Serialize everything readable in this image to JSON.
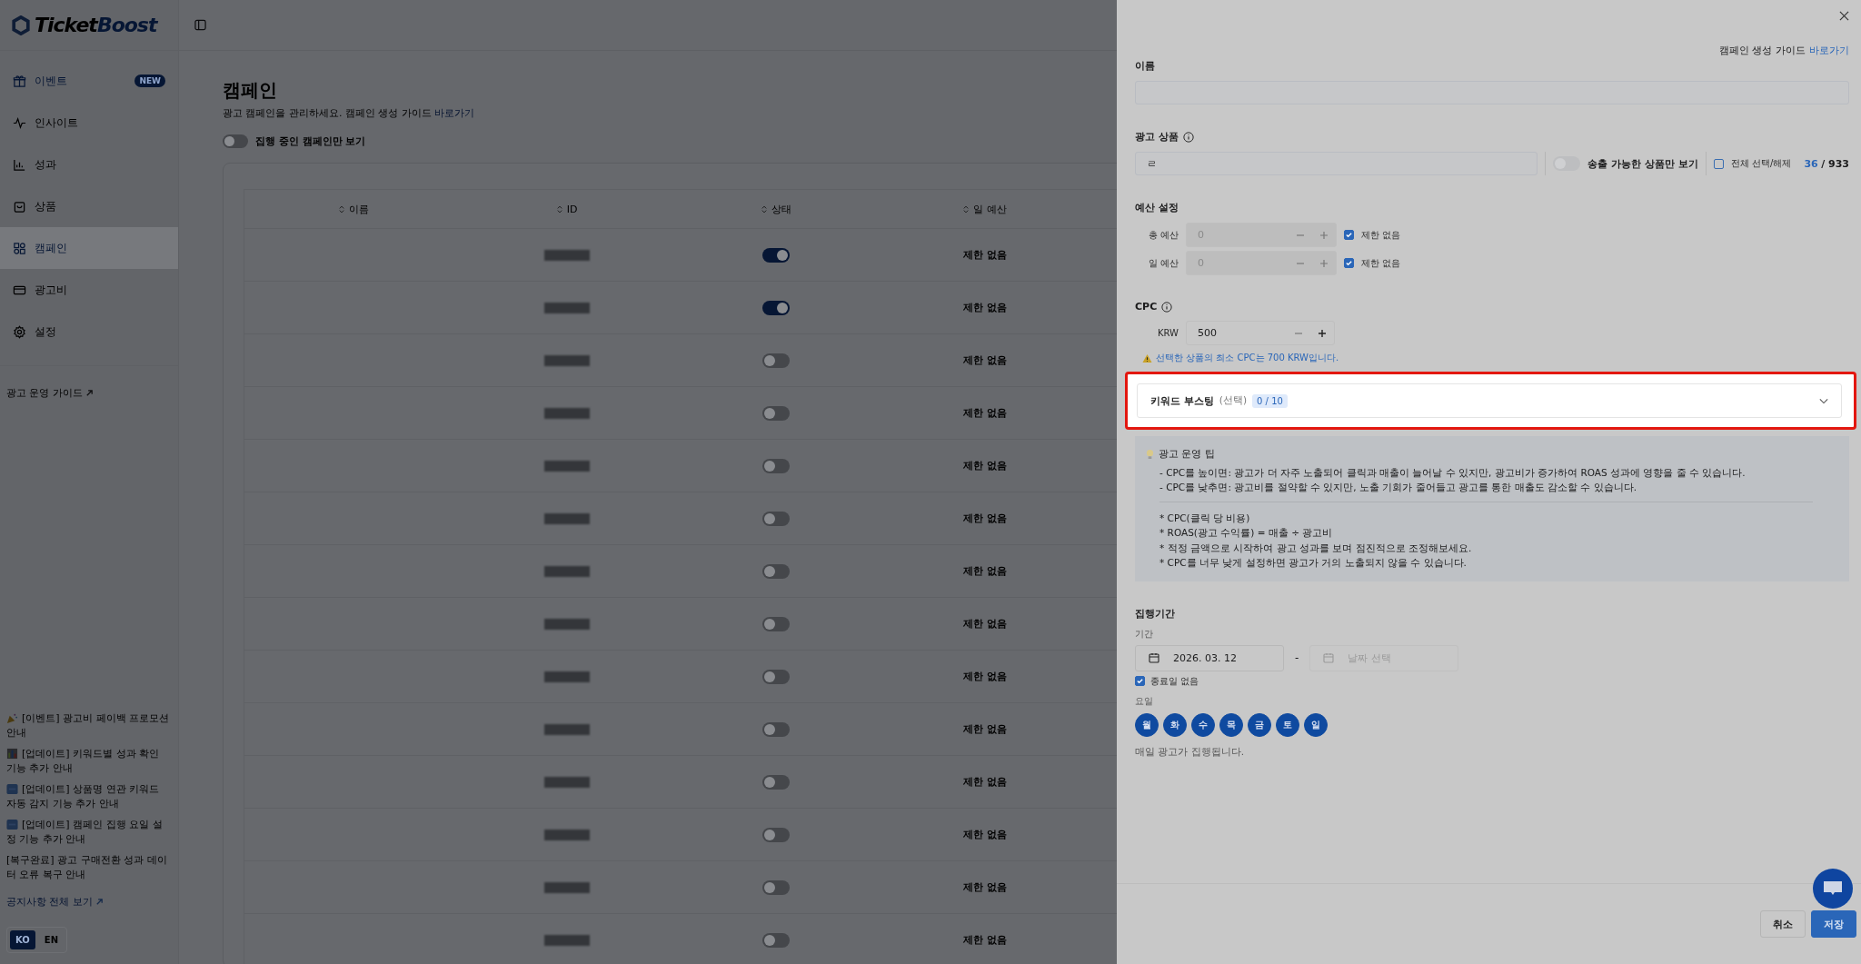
{
  "brand": {
    "parts": [
      "Ticket",
      "Boost"
    ]
  },
  "sidebar": {
    "items": [
      {
        "kind": "gift",
        "label": "이벤트",
        "badge": "NEW",
        "highlight": true,
        "selected": false
      },
      {
        "kind": "activity",
        "label": "인사이트",
        "highlight": false,
        "selected": false
      },
      {
        "kind": "chart",
        "label": "성과",
        "highlight": false,
        "selected": false
      },
      {
        "kind": "bag",
        "label": "상품",
        "highlight": false,
        "selected": false
      },
      {
        "kind": "grid",
        "label": "캠페인",
        "highlight": true,
        "selected": true
      },
      {
        "kind": "card",
        "label": "광고비",
        "highlight": false,
        "selected": false
      },
      {
        "kind": "gear",
        "label": "설정",
        "highlight": false,
        "selected": false
      }
    ],
    "guide_link": "광고 운영 가이드",
    "notices": [
      {
        "kind": "party",
        "text": "[이벤트] 광고비 페이백 프로모션 안내"
      },
      {
        "kind": "chart",
        "text": "[업데이트] 키워드별 성과 확인 기능 추가 안내"
      },
      {
        "kind": "new",
        "text": "[업데이트] 상품명 연관 키워드 자동 감지 기능 추가 안내"
      },
      {
        "kind": "new",
        "text": "[업데이트] 캠페인 집행 요일 설정 기능 추가 안내"
      },
      {
        "kind": "plain",
        "text": "[복구완료] 광고 구매전환 성과 데이터 오류 복구 안내"
      }
    ],
    "notices_all": "공지사항 전체 보기",
    "languages": [
      {
        "label": "KO",
        "selected": true
      },
      {
        "label": "EN",
        "selected": false
      }
    ]
  },
  "page": {
    "title": "캠페인",
    "subtitle": "광고 캠페인을 관리하세요. 캠페인 생성 가이드",
    "subtitle_link": "바로가기",
    "filter": {
      "label": "집행 중인 캠페인만 보기",
      "on": false
    }
  },
  "table": {
    "columns": [
      "이름",
      "ID",
      "상태",
      "일 예산"
    ],
    "rows": [
      {
        "status_on": true,
        "daily_budget": "제한 없음"
      },
      {
        "status_on": true,
        "daily_budget": "제한 없음"
      },
      {
        "status_on": false,
        "daily_budget": "제한 없음"
      },
      {
        "status_on": false,
        "daily_budget": "제한 없음"
      },
      {
        "status_on": false,
        "daily_budget": "제한 없음"
      },
      {
        "status_on": false,
        "daily_budget": "제한 없음"
      },
      {
        "status_on": false,
        "daily_budget": "제한 없음"
      },
      {
        "status_on": false,
        "daily_budget": "제한 없음"
      },
      {
        "status_on": false,
        "daily_budget": "제한 없음"
      },
      {
        "status_on": false,
        "daily_budget": "제한 없음"
      },
      {
        "status_on": false,
        "daily_budget": "제한 없음"
      },
      {
        "status_on": false,
        "daily_budget": "제한 없음"
      },
      {
        "status_on": false,
        "daily_budget": "제한 없음"
      },
      {
        "status_on": false,
        "daily_budget": "제한 없음"
      }
    ]
  },
  "drawer": {
    "guide": "캠페인 생성 가이드",
    "guide_link": "바로가기",
    "name_label": "이름",
    "product": {
      "label": "광고 상품",
      "value": "ㄹ",
      "toggle_label": "송출 가능한 상품만 보기",
      "toggle_on": false,
      "select_all_label": "전체 선택/해제",
      "select_all_checked": false,
      "selected_count": "36",
      "total_count": "/ 933"
    },
    "budget": {
      "label": "예산 설정",
      "rows": [
        {
          "label": "총 예산",
          "value": "0",
          "unlimited_label": "제한 없음",
          "unlimited": true
        },
        {
          "label": "일 예산",
          "value": "0",
          "unlimited_label": "제한 없음",
          "unlimited": true
        }
      ]
    },
    "cpc": {
      "label": "CPC",
      "currency": "KRW",
      "value": "500",
      "warning": "선택한 상품의 최소 CPC는 700 KRW입니다."
    },
    "keyword_boost": {
      "label": "키워드 부스팅",
      "hint": "(선택)",
      "count": "0 / 10",
      "expanded": false,
      "highlighted": true
    },
    "tips": {
      "title": "광고 운영 팁",
      "lines": [
        "- CPC를 높이면: 광고가 더 자주 노출되어 클릭과 매출이 늘어날 수 있지만, 광고비가 증가하여 ROAS 성과에 영향을 줄 수 있습니다.",
        "- CPC를 낮추면: 광고비를 절약할 수 있지만, 노출 기회가 줄어들고 광고를 통한 매출도 감소할 수 있습니다."
      ],
      "notes": [
        "* CPC(클릭 당 비용)",
        "* ROAS(광고 수익률) = 매출 ÷ 광고비",
        "* 적정 금액으로 시작하여 광고 성과를 보며 점진적으로 조정해보세요.",
        "* CPC를 너무 낮게 설정하면 광고가 거의 노출되지 않을 수 있습니다."
      ]
    },
    "schedule": {
      "label": "집행기간",
      "period_label": "기간",
      "start": "2026. 03. 12",
      "separator": "-",
      "end_placeholder": "날짜 선택",
      "no_end_label": "종료일 없음",
      "no_end": true,
      "days_label": "요일",
      "days": [
        {
          "label": "월",
          "selected": true
        },
        {
          "label": "화",
          "selected": true
        },
        {
          "label": "수",
          "selected": true
        },
        {
          "label": "목",
          "selected": true
        },
        {
          "label": "금",
          "selected": true
        },
        {
          "label": "토",
          "selected": true
        },
        {
          "label": "일",
          "selected": true
        }
      ],
      "note": "매일 광고가 집행됩니다."
    },
    "buttons": [
      {
        "label": "취소",
        "kind": "secondary"
      },
      {
        "label": "저장",
        "kind": "primary"
      }
    ]
  }
}
